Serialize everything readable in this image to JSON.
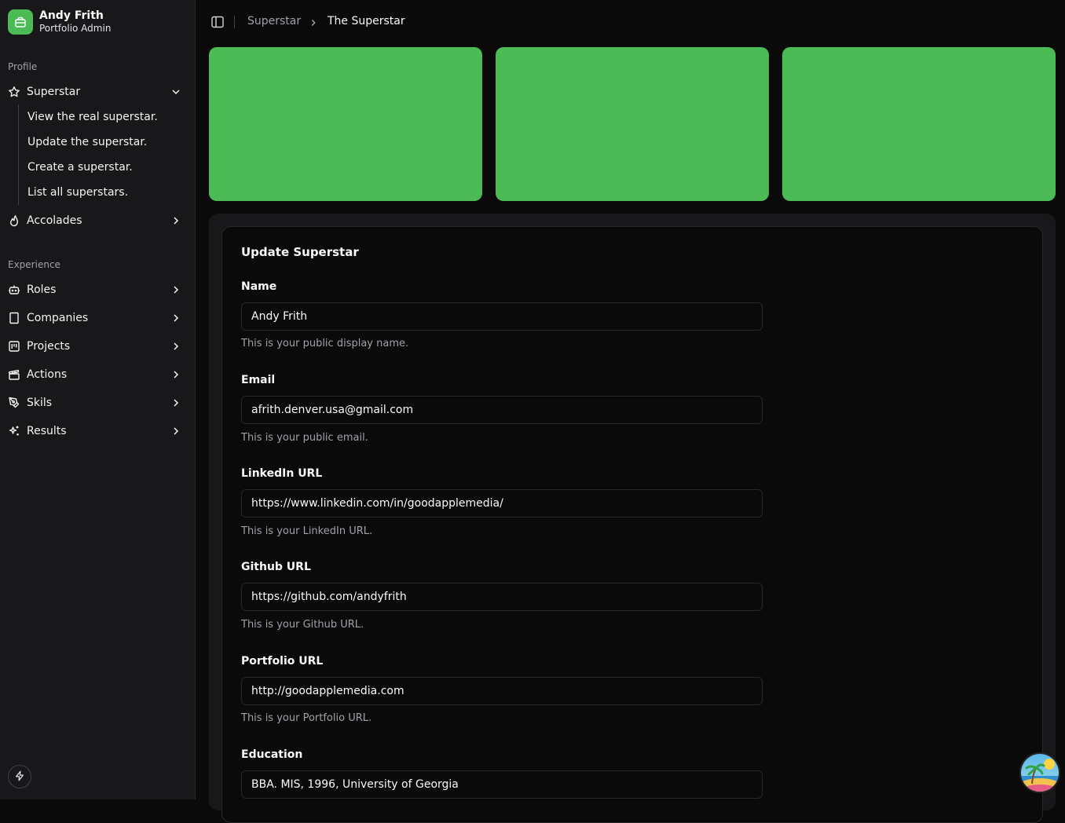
{
  "brand": {
    "name": "Andy Frith",
    "subtitle": "Portfolio Admin",
    "accent": "#4cbb55",
    "icon": "briefcase-icon"
  },
  "sidebar": {
    "groups": [
      {
        "label": "Profile",
        "items": [
          {
            "label": "Superstar",
            "icon": "star-icon",
            "expanded": true,
            "children": [
              "View the real superstar.",
              "Update the superstar.",
              "Create a superstar.",
              "List all superstars."
            ]
          },
          {
            "label": "Accolades",
            "icon": "flame-icon"
          }
        ]
      },
      {
        "label": "Experience",
        "items": [
          {
            "label": "Roles",
            "icon": "bot-icon"
          },
          {
            "label": "Companies",
            "icon": "building-icon"
          },
          {
            "label": "Projects",
            "icon": "kanban-icon"
          },
          {
            "label": "Actions",
            "icon": "clapperboard-icon"
          },
          {
            "label": "Skils",
            "icon": "pen-tool-icon"
          },
          {
            "label": "Results",
            "icon": "sparkles-icon"
          }
        ]
      }
    ],
    "bottom_icon": "lightning-icon"
  },
  "header": {
    "breadcrumb": [
      "Superstar",
      "The Superstar"
    ],
    "toggle_icon": "sidebar-toggle-icon"
  },
  "cards_color": "#4cbb55",
  "form": {
    "title": "Update Superstar",
    "fields": [
      {
        "label": "Name",
        "value": "Andy Frith",
        "help": "This is your public display name."
      },
      {
        "label": "Email",
        "value": "afrith.denver.usa@gmail.com",
        "help": "This is your public email."
      },
      {
        "label": "LinkedIn URL",
        "value": "https://www.linkedin.com/in/goodapplemedia/",
        "help": "This is your LinkedIn URL."
      },
      {
        "label": "Github URL",
        "value": "https://github.com/andyfrith",
        "help": "This is your Github URL."
      },
      {
        "label": "Portfolio URL",
        "value": "http://goodapplemedia.com",
        "help": "This is your Portfolio URL."
      },
      {
        "label": "Education",
        "value": "BBA. MIS, 1996, University of Georgia",
        "help": ""
      }
    ]
  },
  "avatar_icon": "island-avatar-icon"
}
